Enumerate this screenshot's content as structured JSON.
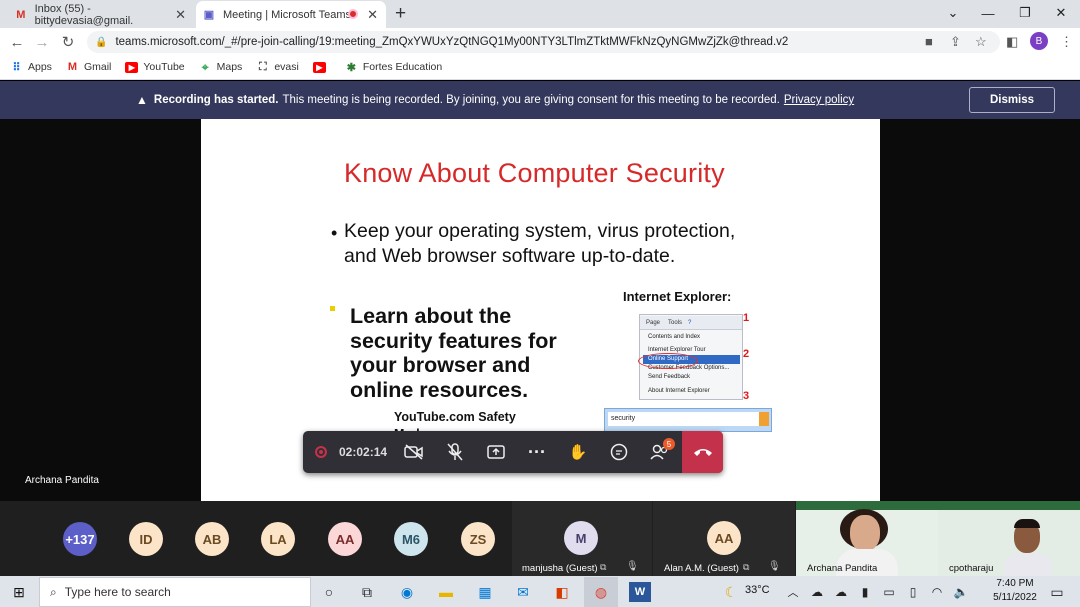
{
  "browser": {
    "tabs": [
      {
        "title": "Inbox (55) - bittydevasia@gmail.",
        "icon": "gmail-icon"
      },
      {
        "title": "Meeting | Microsoft Teams",
        "icon": "teams-icon"
      }
    ],
    "new_tab": "+",
    "url": "teams.microsoft.com/_#/pre-join-calling/19:meeting_ZmQxYWUxYzQtNGQ1My00NTY3LTlmZTktMWFkNzQyNGMwZjZk@thread.v2",
    "profile_initial": "B",
    "bookmarks": [
      "Apps",
      "Gmail",
      "YouTube",
      "Maps",
      "evasi",
      "",
      "Fortes Education"
    ]
  },
  "banner": {
    "bold": "Recording has started.",
    "text": "This meeting is being recorded. By joining, you are giving consent for this meeting to be recorded.",
    "link": "Privacy policy",
    "dismiss": "Dismiss"
  },
  "slide": {
    "title": "Know About Computer Security",
    "bullet1": "Keep your operating system, virus protection, and Web browser software up-to-date.",
    "bullet2": "Learn about the security features for your browser and online resources.",
    "ie_label": "Internet Explorer:",
    "ie_menu": [
      "Page",
      "Tools",
      "Contents and Index",
      "Internet Explorer Tour",
      "Online Support",
      "Customer Feedback Options...",
      "Send Feedback",
      "About Internet Explorer"
    ],
    "ie_numbers": [
      "1",
      "2",
      "3"
    ],
    "ie_search": "security",
    "yt_text": "YouTube.com Safety Mode"
  },
  "controls": {
    "timer": "02:02:14",
    "people_badge": "5"
  },
  "presenter_name": "Archana Pandita",
  "participants": [
    {
      "initials": "+137",
      "color": "#5b5fc7",
      "text": "#ffffff"
    },
    {
      "initials": "ID",
      "color": "#fbe4c8",
      "text": "#6b4a22"
    },
    {
      "initials": "AB",
      "color": "#fbe4c8",
      "text": "#6b4a22"
    },
    {
      "initials": "LA",
      "color": "#fbe4c8",
      "text": "#6b4a22"
    },
    {
      "initials": "AA",
      "color": "#fbd7d7",
      "text": "#7a2c2c"
    },
    {
      "initials": "M6",
      "color": "#cfe5ee",
      "text": "#2a5566"
    },
    {
      "initials": "ZS",
      "color": "#fbe4c8",
      "text": "#6b4a22"
    }
  ],
  "tiles": [
    {
      "initials": "M",
      "name": "manjusha (Guest)"
    },
    {
      "initials": "AA",
      "name": "Alan A.M. (Guest)"
    },
    {
      "name": "Archana Pandita"
    },
    {
      "name": "cpotharaju"
    }
  ],
  "taskbar": {
    "search_placeholder": "Type here to search",
    "weather": "33°C",
    "time": "7:40 PM",
    "date": "5/11/2022"
  }
}
